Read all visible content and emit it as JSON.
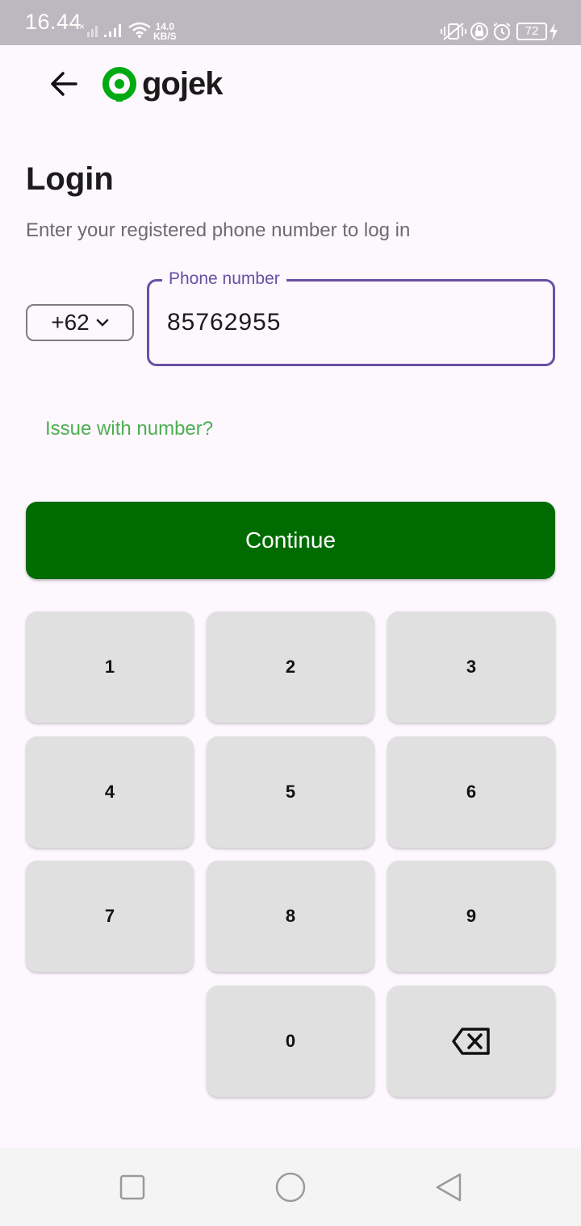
{
  "status_bar": {
    "time": "16.44",
    "net_speed_value": "14.0",
    "net_speed_unit": "KB/S",
    "battery": "72"
  },
  "header": {
    "logo_text": "gojek"
  },
  "login": {
    "title": "Login",
    "subtitle": "Enter your registered phone number to log in",
    "country_code": "+62",
    "phone_label": "Phone number",
    "phone_value": "85762955",
    "issue_link": "Issue with number?",
    "continue_label": "Continue"
  },
  "keypad": {
    "keys": [
      "1",
      "2",
      "3",
      "4",
      "5",
      "6",
      "7",
      "8",
      "9",
      "0"
    ]
  },
  "colors": {
    "accent_purple": "#6a4fa3",
    "brand_green": "#006b00",
    "link_green": "#4caf50"
  }
}
